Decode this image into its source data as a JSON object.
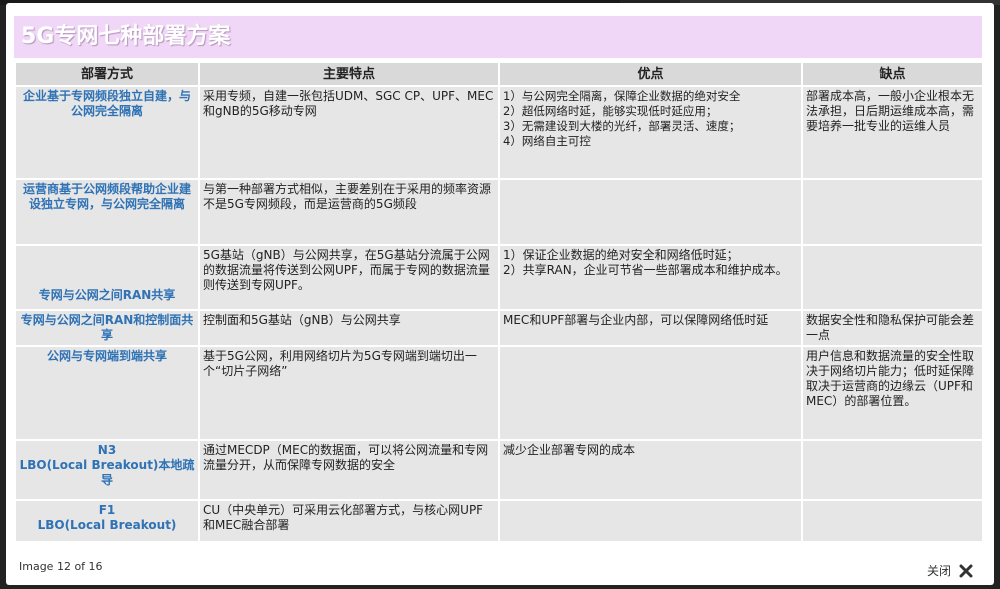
{
  "slide": {
    "title": "5G专网七种部署方案",
    "headers": [
      "部署方式",
      "主要特点",
      "优点",
      "缺点"
    ],
    "rows": [
      {
        "method": "企业基于专网频段独立自建，与公网完全隔离",
        "feature": "采用专频，自建一张包括UDM、SGC CP、UPF、MEC和gNB的5G移动专网",
        "advantage": "1）与公网完全隔离，保障企业数据的绝对安全\n2）超低网络时延，能够实现低时延应用；\n3）无需建设到大楼的光纤，部署灵活、速度；\n4）网络自主可控",
        "disadvantage": "部署成本高，一般小企业根本无法承担，日后期运维成本高，需要培养一批专业的运维人员"
      },
      {
        "method": "运营商基于公网频段帮助企业建设独立专网，与公网完全隔离",
        "feature": "与第一种部署方式相似，主要差别在于采用的频率资源不是5G专网频段，而是运营商的5G频段",
        "advantage": "",
        "disadvantage": ""
      },
      {
        "method": "专网与公网之间RAN共享",
        "feature": "5G基站（gNB）与公网共享，在5G基站分流属于公网的数据流量将传送到公网UPF，而属于专网的数据流量则传送到专网UPF。",
        "advantage": "1）保证企业数据的绝对安全和网络低时延；\n2）共享RAN，企业可节省一些部署成本和维护成本。",
        "disadvantage": ""
      },
      {
        "method": "专网与公网之间RAN和控制面共享",
        "feature": "控制面和5G基站（gNB）与公网共享",
        "advantage": "MEC和UPF部署与企业内部，可以保障网络低时延",
        "disadvantage": "数据安全性和隐私保护可能会差一点"
      },
      {
        "method": "公网与专网端到端共享",
        "feature": "基于5G公网，利用网络切片为5G专网端到端切出一个“切片子网络”",
        "advantage": "",
        "disadvantage": "用户信息和数据流量的安全性取决于网络切片能力；低时延保障取决于运营商的边缘云（UPF和MEC）的部署位置。"
      },
      {
        "method": "N3\nLBO(Local Breakout)本地疏导",
        "feature": "通过MECDP（MEC的数据面，可以将公网流量和专网流量分开，从而保障专网数据的安全",
        "advantage": "减少企业部署专网的成本",
        "disadvantage": ""
      },
      {
        "method": "F1\nLBO(Local Breakout)",
        "feature": "CU（中央单元）可采用云化部署方式，与核心网UPF和MEC融合部署",
        "advantage": "",
        "disadvantage": ""
      }
    ]
  },
  "footer": {
    "image_counter": "Image 12 of 16",
    "close_label": "关闭",
    "close_icon": "close-icon"
  },
  "colors": {
    "banner": "#f1d7f7",
    "header_cell": "#d9d9d9",
    "body_cell": "#e6e6e6",
    "method_text": "#2f72b5"
  }
}
